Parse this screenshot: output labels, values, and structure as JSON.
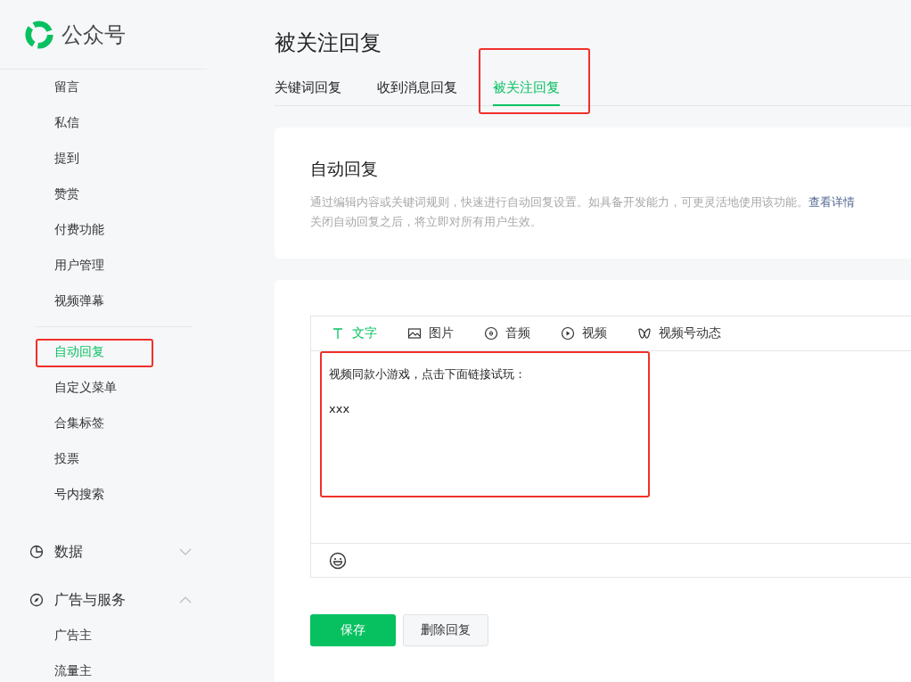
{
  "logo": {
    "text": "公众号"
  },
  "sidebar": {
    "sections": [
      {
        "items": [
          {
            "label": "留言",
            "selected": false,
            "highlighted": false
          },
          {
            "label": "私信",
            "selected": false,
            "highlighted": false
          },
          {
            "label": "提到",
            "selected": false,
            "highlighted": false
          },
          {
            "label": "赞赏",
            "selected": false,
            "highlighted": false
          },
          {
            "label": "付费功能",
            "selected": false,
            "highlighted": false
          },
          {
            "label": "用户管理",
            "selected": false,
            "highlighted": false
          },
          {
            "label": "视频弹幕",
            "selected": false,
            "highlighted": false
          }
        ]
      },
      {
        "items": [
          {
            "label": "自动回复",
            "selected": true,
            "highlighted": true
          },
          {
            "label": "自定义菜单",
            "selected": false,
            "highlighted": false
          },
          {
            "label": "合集标签",
            "selected": false,
            "highlighted": false
          },
          {
            "label": "投票",
            "selected": false,
            "highlighted": false
          },
          {
            "label": "号内搜索",
            "selected": false,
            "highlighted": false
          }
        ]
      }
    ],
    "groups": [
      {
        "label": "数据",
        "expanded": false
      },
      {
        "label": "广告与服务",
        "expanded": true,
        "children": [
          {
            "label": "广告主",
            "selected": false
          },
          {
            "label": "流量主",
            "selected": false
          }
        ]
      }
    ]
  },
  "page": {
    "title": "被关注回复",
    "tabs": [
      {
        "label": "关键词回复",
        "selected": false,
        "highlighted": false
      },
      {
        "label": "收到消息回复",
        "selected": false,
        "highlighted": false
      },
      {
        "label": "被关注回复",
        "selected": true,
        "highlighted": true
      }
    ]
  },
  "info_card": {
    "title": "自动回复",
    "description": "通过编辑内容或关键词规则，快速进行自动回复设置。如具备开发能力，可更灵活地使用该功能。",
    "link": "查看详情",
    "note": "关闭自动回复之后，将立即对所有用户生效。"
  },
  "editor": {
    "tabs": [
      {
        "label": "文字",
        "selected": true
      },
      {
        "label": "图片",
        "selected": false
      },
      {
        "label": "音频",
        "selected": false
      },
      {
        "label": "视频",
        "selected": false
      },
      {
        "label": "视频号动态",
        "selected": false
      }
    ],
    "content": {
      "highlighted": true,
      "paragraphs": [
        "视频同款小游戏，点击下面链接试玩：",
        "xxx"
      ]
    }
  },
  "buttons": [
    {
      "label": "保存",
      "kind": "primary"
    },
    {
      "label": "删除回复",
      "kind": "default"
    }
  ]
}
